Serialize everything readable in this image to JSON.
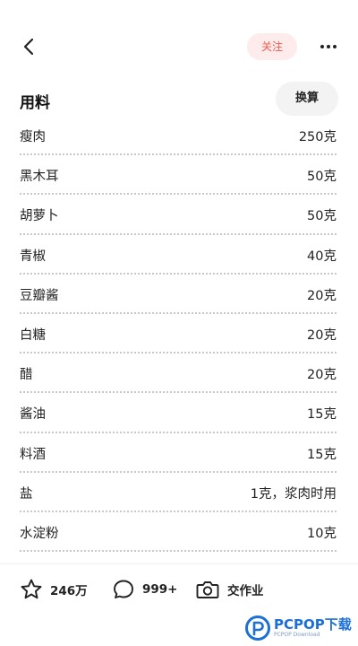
{
  "header": {
    "follow_label": "关注"
  },
  "section": {
    "title": "用料",
    "convert_label": "换算"
  },
  "ingredients": [
    {
      "name": "瘦肉",
      "amount": "250克"
    },
    {
      "name": "黑木耳",
      "amount": "50克"
    },
    {
      "name": "胡萝卜",
      "amount": "50克"
    },
    {
      "name": "青椒",
      "amount": "40克"
    },
    {
      "name": "豆瓣酱",
      "amount": "20克"
    },
    {
      "name": "白糖",
      "amount": "20克"
    },
    {
      "name": "醋",
      "amount": "20克"
    },
    {
      "name": "酱油",
      "amount": "15克"
    },
    {
      "name": "料酒",
      "amount": "15克"
    },
    {
      "name": "盐",
      "amount": "1克，浆肉时用"
    },
    {
      "name": "水淀粉",
      "amount": "10克"
    }
  ],
  "bottom_bar": {
    "favorite_count": "246万",
    "comment_count": "999+",
    "homework_label": "交作业"
  },
  "watermark": {
    "brand": "PCPOP下载",
    "sub": "PCPOP Download"
  },
  "colors": {
    "accent": "#ef5a4e",
    "follow_bg": "#fdeceb",
    "button_bg": "#f3f3f3"
  },
  "icons": {
    "back": "chevron-left-icon",
    "more": "more-dots-icon",
    "favorite": "star-icon",
    "comment": "comment-bubble-icon",
    "homework": "camera-icon"
  }
}
